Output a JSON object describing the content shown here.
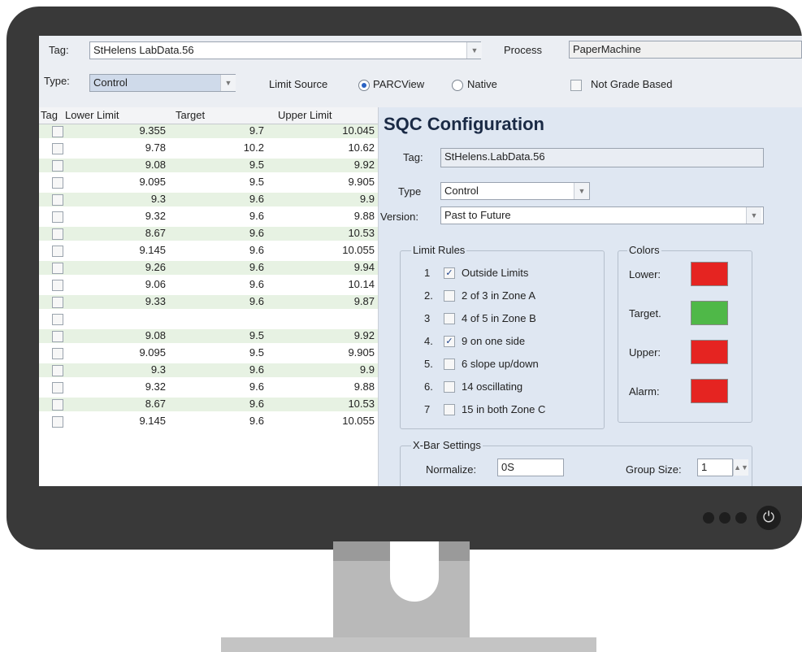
{
  "toolbar": {
    "tag_label": "Tag:",
    "tag_value": "StHelens LabData.56",
    "process_label": "Process",
    "process_value": "PaperMachine",
    "type_label": "Type:",
    "type_value": "Control",
    "limit_source_label": "Limit Source",
    "radio_parcview": "PARCView",
    "radio_native": "Native",
    "selected_source": "PARCView",
    "not_grade_based": "Not Grade Based"
  },
  "grid": {
    "columns": [
      "Tag",
      "Lower Limit",
      "Target",
      "Upper Limit"
    ],
    "rows": [
      {
        "lower": "9.355",
        "target": "9.7",
        "upper": "10.045"
      },
      {
        "lower": "9.78",
        "target": "10.2",
        "upper": "10.62"
      },
      {
        "lower": "9.08",
        "target": "9.5",
        "upper": "9.92"
      },
      {
        "lower": "9.095",
        "target": "9.5",
        "upper": "9.905"
      },
      {
        "lower": "9.3",
        "target": "9.6",
        "upper": "9.9"
      },
      {
        "lower": "9.32",
        "target": "9.6",
        "upper": "9.88"
      },
      {
        "lower": "8.67",
        "target": "9.6",
        "upper": "10.53"
      },
      {
        "lower": "9.145",
        "target": "9.6",
        "upper": "10.055"
      },
      {
        "lower": "9.26",
        "target": "9.6",
        "upper": "9.94"
      },
      {
        "lower": "9.06",
        "target": "9.6",
        "upper": "10.14"
      },
      {
        "lower": "9.33",
        "target": "9.6",
        "upper": "9.87"
      },
      {
        "lower": "",
        "target": "",
        "upper": ""
      },
      {
        "lower": "9.08",
        "target": "9.5",
        "upper": "9.92"
      },
      {
        "lower": "9.095",
        "target": "9.5",
        "upper": "9.905"
      },
      {
        "lower": "9.3",
        "target": "9.6",
        "upper": "9.9"
      },
      {
        "lower": "9.32",
        "target": "9.6",
        "upper": "9.88"
      },
      {
        "lower": "8.67",
        "target": "9.6",
        "upper": "10.53"
      },
      {
        "lower": "9.145",
        "target": "9.6",
        "upper": "10.055"
      }
    ]
  },
  "sqc": {
    "title": "SQC Configuration",
    "tag_label": "Tag:",
    "tag_value": "StHelens.LabData.56",
    "type_label": "Type",
    "type_value": "Control",
    "version_label": "Version:",
    "version_value": "Past to Future",
    "limit_rules_label": "Limit Rules",
    "rules": [
      {
        "num": "1",
        "text": "Outside Limits",
        "checked": true
      },
      {
        "num": "2.",
        "text": "2 of 3 in Zone A",
        "checked": false
      },
      {
        "num": "3",
        "text": "4 of 5 in Zone B",
        "checked": false
      },
      {
        "num": "4.",
        "text": "9 on one side",
        "checked": true
      },
      {
        "num": "5.",
        "text": "6 slope up/down",
        "checked": false
      },
      {
        "num": "6.",
        "text": "14 oscillating",
        "checked": false
      },
      {
        "num": "7",
        "text": "15 in both Zone C",
        "checked": false
      }
    ],
    "colors_label": "Colors",
    "colors": [
      {
        "label": "Lower:",
        "color": "#e52421"
      },
      {
        "label": "Target.",
        "color": "#4fb848"
      },
      {
        "label": "Upper:",
        "color": "#e52421"
      },
      {
        "label": "Alarm:",
        "color": "#e52421"
      }
    ],
    "xbar_label": "X-Bar Settings",
    "normalize_label": "Normalize:",
    "normalize_value": "0S",
    "group_size_label": "Group Size:",
    "group_size_value": "1"
  }
}
